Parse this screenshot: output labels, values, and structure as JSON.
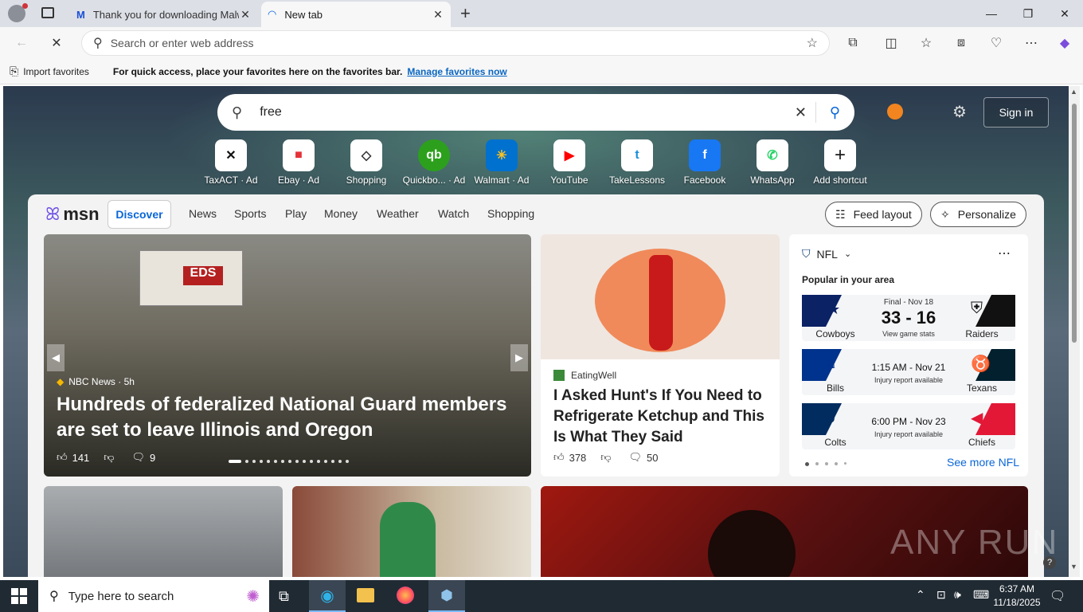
{
  "tabs": [
    {
      "title": "Thank you for downloading Malw",
      "close": "✕"
    },
    {
      "title": "New tab",
      "close": "✕"
    }
  ],
  "toolbar": {
    "address_placeholder": "Search or enter web address"
  },
  "favorites_bar": {
    "import_label": "Import favorites",
    "hint": "For quick access, place your favorites here on the favorites bar.",
    "manage_link": "Manage favorites now"
  },
  "search": {
    "value": "free"
  },
  "signin": "Sign in",
  "shortcuts": [
    {
      "label": "TaxACT",
      "ad": "Ad",
      "glyph": "✕",
      "color": "#111"
    },
    {
      "label": "Ebay",
      "ad": "Ad",
      "glyph": "🛍",
      "color": "#e53238"
    },
    {
      "label": "Shopping",
      "ad": "",
      "glyph": "🏷",
      "color": "#333"
    },
    {
      "label": "Quickbo...",
      "ad": "Ad",
      "glyph": "qb",
      "color": "#2ca01c"
    },
    {
      "label": "Walmart",
      "ad": "Ad",
      "glyph": "✳",
      "color": "#0071ce"
    },
    {
      "label": "YouTube",
      "ad": "",
      "glyph": "▶",
      "color": "#ff0000"
    },
    {
      "label": "TakeLessons",
      "ad": "",
      "glyph": "t",
      "color": "#1a8fd8"
    },
    {
      "label": "Facebook",
      "ad": "",
      "glyph": "f",
      "color": "#1877f2"
    },
    {
      "label": "WhatsApp",
      "ad": "",
      "glyph": "✆",
      "color": "#25d366"
    },
    {
      "label": "Add shortcut",
      "ad": "",
      "glyph": "+",
      "color": "#333"
    }
  ],
  "msn": {
    "brand": "msn",
    "nav": [
      "Discover",
      "News",
      "Sports",
      "Play",
      "Money",
      "Weather",
      "Watch",
      "Shopping"
    ],
    "feed_layout": "Feed layout",
    "personalize": "Personalize"
  },
  "hero": {
    "source": "NBC News · 5h",
    "title": "Hundreds of federalized National Guard members are set to leave Illinois and Oregon",
    "likes": "141",
    "comments": "9"
  },
  "card2": {
    "source": "EatingWell",
    "title": "I Asked Hunt's If You Need to Refrigerate Ketchup and This Is What They Said",
    "likes": "378",
    "comments": "50"
  },
  "nfl": {
    "header": "NFL",
    "subheader": "Popular in your area",
    "games": [
      {
        "home": "Cowboys",
        "away": "Raiders",
        "status": "Final - Nov 18",
        "score": "33 - 16",
        "note": "View game stats"
      },
      {
        "home": "Bills",
        "away": "Texans",
        "status": "1:15 AM - Nov 21",
        "score": "",
        "note": "Injury report available"
      },
      {
        "home": "Colts",
        "away": "Chiefs",
        "status": "6:00 PM - Nov 23",
        "score": "",
        "note": "Injury report available"
      }
    ],
    "more": "See more NFL"
  },
  "taskbar": {
    "search_placeholder": "Type here to search",
    "time": "6:37 AM",
    "date": "11/18/2025"
  },
  "watermark": "ANY RUN"
}
